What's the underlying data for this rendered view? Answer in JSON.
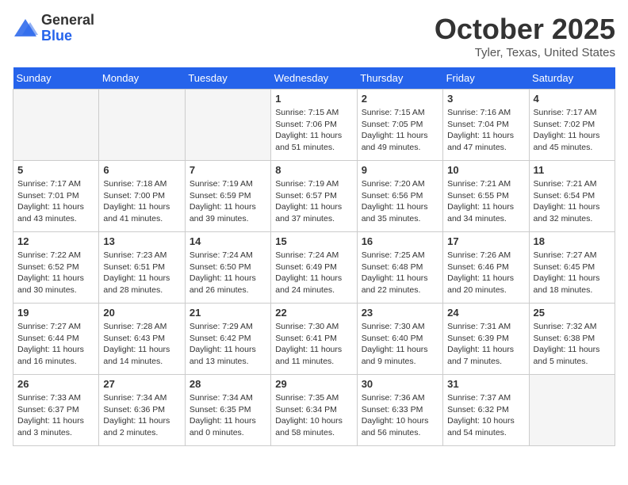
{
  "header": {
    "logo_general": "General",
    "logo_blue": "Blue",
    "title": "October 2025",
    "subtitle": "Tyler, Texas, United States"
  },
  "weekdays": [
    "Sunday",
    "Monday",
    "Tuesday",
    "Wednesday",
    "Thursday",
    "Friday",
    "Saturday"
  ],
  "weeks": [
    [
      {
        "num": "",
        "sunrise": "",
        "sunset": "",
        "daylight": ""
      },
      {
        "num": "",
        "sunrise": "",
        "sunset": "",
        "daylight": ""
      },
      {
        "num": "",
        "sunrise": "",
        "sunset": "",
        "daylight": ""
      },
      {
        "num": "1",
        "sunrise": "Sunrise: 7:15 AM",
        "sunset": "Sunset: 7:06 PM",
        "daylight": "Daylight: 11 hours and 51 minutes."
      },
      {
        "num": "2",
        "sunrise": "Sunrise: 7:15 AM",
        "sunset": "Sunset: 7:05 PM",
        "daylight": "Daylight: 11 hours and 49 minutes."
      },
      {
        "num": "3",
        "sunrise": "Sunrise: 7:16 AM",
        "sunset": "Sunset: 7:04 PM",
        "daylight": "Daylight: 11 hours and 47 minutes."
      },
      {
        "num": "4",
        "sunrise": "Sunrise: 7:17 AM",
        "sunset": "Sunset: 7:02 PM",
        "daylight": "Daylight: 11 hours and 45 minutes."
      }
    ],
    [
      {
        "num": "5",
        "sunrise": "Sunrise: 7:17 AM",
        "sunset": "Sunset: 7:01 PM",
        "daylight": "Daylight: 11 hours and 43 minutes."
      },
      {
        "num": "6",
        "sunrise": "Sunrise: 7:18 AM",
        "sunset": "Sunset: 7:00 PM",
        "daylight": "Daylight: 11 hours and 41 minutes."
      },
      {
        "num": "7",
        "sunrise": "Sunrise: 7:19 AM",
        "sunset": "Sunset: 6:59 PM",
        "daylight": "Daylight: 11 hours and 39 minutes."
      },
      {
        "num": "8",
        "sunrise": "Sunrise: 7:19 AM",
        "sunset": "Sunset: 6:57 PM",
        "daylight": "Daylight: 11 hours and 37 minutes."
      },
      {
        "num": "9",
        "sunrise": "Sunrise: 7:20 AM",
        "sunset": "Sunset: 6:56 PM",
        "daylight": "Daylight: 11 hours and 35 minutes."
      },
      {
        "num": "10",
        "sunrise": "Sunrise: 7:21 AM",
        "sunset": "Sunset: 6:55 PM",
        "daylight": "Daylight: 11 hours and 34 minutes."
      },
      {
        "num": "11",
        "sunrise": "Sunrise: 7:21 AM",
        "sunset": "Sunset: 6:54 PM",
        "daylight": "Daylight: 11 hours and 32 minutes."
      }
    ],
    [
      {
        "num": "12",
        "sunrise": "Sunrise: 7:22 AM",
        "sunset": "Sunset: 6:52 PM",
        "daylight": "Daylight: 11 hours and 30 minutes."
      },
      {
        "num": "13",
        "sunrise": "Sunrise: 7:23 AM",
        "sunset": "Sunset: 6:51 PM",
        "daylight": "Daylight: 11 hours and 28 minutes."
      },
      {
        "num": "14",
        "sunrise": "Sunrise: 7:24 AM",
        "sunset": "Sunset: 6:50 PM",
        "daylight": "Daylight: 11 hours and 26 minutes."
      },
      {
        "num": "15",
        "sunrise": "Sunrise: 7:24 AM",
        "sunset": "Sunset: 6:49 PM",
        "daylight": "Daylight: 11 hours and 24 minutes."
      },
      {
        "num": "16",
        "sunrise": "Sunrise: 7:25 AM",
        "sunset": "Sunset: 6:48 PM",
        "daylight": "Daylight: 11 hours and 22 minutes."
      },
      {
        "num": "17",
        "sunrise": "Sunrise: 7:26 AM",
        "sunset": "Sunset: 6:46 PM",
        "daylight": "Daylight: 11 hours and 20 minutes."
      },
      {
        "num": "18",
        "sunrise": "Sunrise: 7:27 AM",
        "sunset": "Sunset: 6:45 PM",
        "daylight": "Daylight: 11 hours and 18 minutes."
      }
    ],
    [
      {
        "num": "19",
        "sunrise": "Sunrise: 7:27 AM",
        "sunset": "Sunset: 6:44 PM",
        "daylight": "Daylight: 11 hours and 16 minutes."
      },
      {
        "num": "20",
        "sunrise": "Sunrise: 7:28 AM",
        "sunset": "Sunset: 6:43 PM",
        "daylight": "Daylight: 11 hours and 14 minutes."
      },
      {
        "num": "21",
        "sunrise": "Sunrise: 7:29 AM",
        "sunset": "Sunset: 6:42 PM",
        "daylight": "Daylight: 11 hours and 13 minutes."
      },
      {
        "num": "22",
        "sunrise": "Sunrise: 7:30 AM",
        "sunset": "Sunset: 6:41 PM",
        "daylight": "Daylight: 11 hours and 11 minutes."
      },
      {
        "num": "23",
        "sunrise": "Sunrise: 7:30 AM",
        "sunset": "Sunset: 6:40 PM",
        "daylight": "Daylight: 11 hours and 9 minutes."
      },
      {
        "num": "24",
        "sunrise": "Sunrise: 7:31 AM",
        "sunset": "Sunset: 6:39 PM",
        "daylight": "Daylight: 11 hours and 7 minutes."
      },
      {
        "num": "25",
        "sunrise": "Sunrise: 7:32 AM",
        "sunset": "Sunset: 6:38 PM",
        "daylight": "Daylight: 11 hours and 5 minutes."
      }
    ],
    [
      {
        "num": "26",
        "sunrise": "Sunrise: 7:33 AM",
        "sunset": "Sunset: 6:37 PM",
        "daylight": "Daylight: 11 hours and 3 minutes."
      },
      {
        "num": "27",
        "sunrise": "Sunrise: 7:34 AM",
        "sunset": "Sunset: 6:36 PM",
        "daylight": "Daylight: 11 hours and 2 minutes."
      },
      {
        "num": "28",
        "sunrise": "Sunrise: 7:34 AM",
        "sunset": "Sunset: 6:35 PM",
        "daylight": "Daylight: 11 hours and 0 minutes."
      },
      {
        "num": "29",
        "sunrise": "Sunrise: 7:35 AM",
        "sunset": "Sunset: 6:34 PM",
        "daylight": "Daylight: 10 hours and 58 minutes."
      },
      {
        "num": "30",
        "sunrise": "Sunrise: 7:36 AM",
        "sunset": "Sunset: 6:33 PM",
        "daylight": "Daylight: 10 hours and 56 minutes."
      },
      {
        "num": "31",
        "sunrise": "Sunrise: 7:37 AM",
        "sunset": "Sunset: 6:32 PM",
        "daylight": "Daylight: 10 hours and 54 minutes."
      },
      {
        "num": "",
        "sunrise": "",
        "sunset": "",
        "daylight": ""
      }
    ]
  ]
}
